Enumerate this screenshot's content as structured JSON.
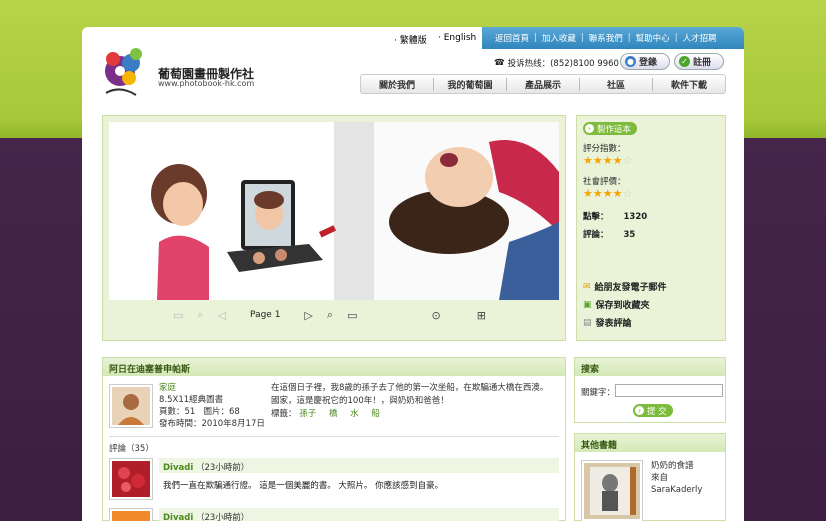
{
  "header": {
    "lang_trad": "繁體版",
    "lang_en": "English",
    "top_links": [
      "返回首頁",
      "加入收藏",
      "聯系我們",
      "幫助中心",
      "人才招聘"
    ],
    "brand": "葡萄園畫冊製作社",
    "site": "www.photobook-hk.com",
    "hotline": "投诉热线：(852)8100 9960",
    "login": "登錄",
    "register": "註冊",
    "nav": [
      "關於我們",
      "我的葡萄園",
      "產品展示",
      "社區",
      "軟件下載"
    ]
  },
  "viewer": {
    "page_label": "Page 1"
  },
  "sidebar": {
    "make_this": "製作這本",
    "rating_label": "評分指數：",
    "rating": 4.5,
    "community_label": "社會評價：",
    "community_rating": 3.5,
    "clicks_label": "點擊：",
    "clicks": "1320",
    "comments_label": "評論：",
    "comments": "35",
    "email_friend": "給朋友發電子郵件",
    "save_fav": "保存到收藏夾",
    "post_comment": "發表評論"
  },
  "album": {
    "title": "阿日在迪塞普申帕斯",
    "author": "家庭",
    "spec": "8.5X11經典圖書",
    "pages": "頁數：51",
    "photos": "圖片：68",
    "published": "發布時間：2010年8月17日",
    "desc1": "在這個日子裡，我8歲的孫子去了他的第一次坐船，在欺騙通大橋在西澳。",
    "desc2": "國家，這是慶祝它的100年！，與奶奶和爸爸！",
    "tags_label": "標籤：",
    "tags": [
      "孫子",
      "橋",
      "水",
      "船"
    ],
    "comments_heading": "評論（35）",
    "c1_user": "Divadi",
    "c1_time": "（23小時前）",
    "c1_text": "我們一直在欺騙通行證。  這是一個美麗的書。  大照片。  你應該感到自豪。",
    "c2_user": "Divadi",
    "c2_time": "（23小時前）"
  },
  "search": {
    "title": "搜索",
    "keyword_label": "關鍵字：",
    "submit": "提 交"
  },
  "others": {
    "title": "其他書籍",
    "book_title": "奶奶的食譜",
    "book_from": "來自",
    "book_author": "SaraKaderly"
  }
}
